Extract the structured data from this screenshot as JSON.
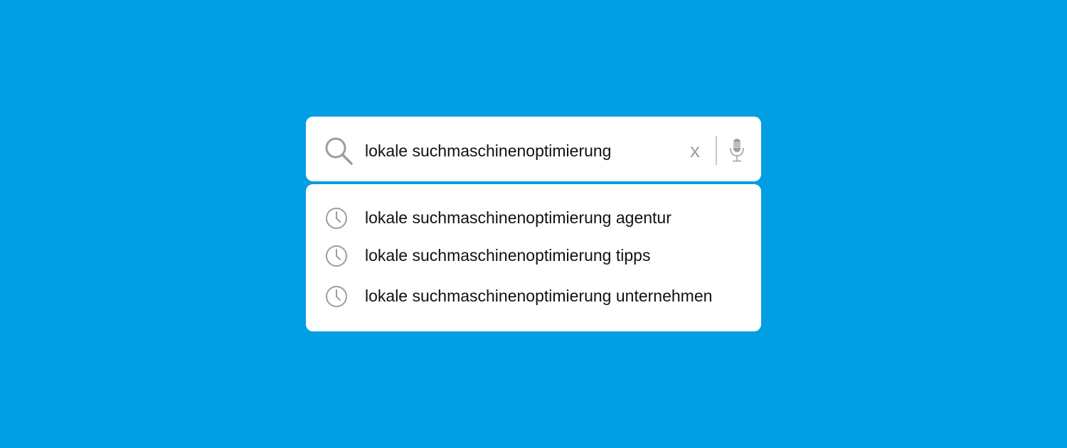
{
  "search": {
    "query": "lokale suchmaschinenoptimierung",
    "clear_label": "x"
  },
  "suggestions": [
    {
      "label": "lokale suchmaschinenoptimierung agentur",
      "icon": "clock-icon"
    },
    {
      "label": "lokale suchmaschinenoptimierung tipps",
      "icon": "clock-icon"
    },
    {
      "label": "lokale suchmaschinenoptimierung unternehmen",
      "icon": "clock-icon"
    }
  ],
  "icons": {
    "search": "search-icon",
    "clear": "close-icon",
    "voice": "microphone-icon"
  },
  "colors": {
    "background": "#009fe3",
    "panel": "#ffffff",
    "icon_gray": "#9d9d9c",
    "text": "#111111"
  }
}
